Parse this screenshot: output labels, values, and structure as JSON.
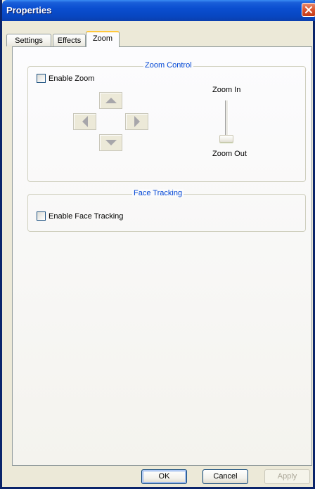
{
  "window": {
    "title": "Properties"
  },
  "tabs": [
    {
      "label": "Settings",
      "active": false
    },
    {
      "label": "Effects",
      "active": false
    },
    {
      "label": "Zoom",
      "active": true
    }
  ],
  "zoom_control": {
    "legend": "Zoom Control",
    "enable_zoom": {
      "label": "Enable Zoom",
      "checked": false
    },
    "arrows": {
      "up": "up-arrow-icon",
      "left": "left-arrow-icon",
      "right": "right-arrow-icon",
      "down": "down-arrow-icon"
    },
    "slider": {
      "top_label": "Zoom In",
      "bottom_label": "Zoom Out"
    }
  },
  "face_tracking": {
    "legend": "Face Tracking",
    "enable_face_tracking": {
      "label": "Enable Face Tracking",
      "checked": false
    }
  },
  "buttons": {
    "ok": "OK",
    "cancel": "Cancel",
    "apply": "Apply"
  },
  "colors": {
    "title_bar": "#0a4ed0",
    "group_legend": "#0046d5",
    "close_button": "#d9532f",
    "active_tab_accent": "#ffc83c"
  }
}
